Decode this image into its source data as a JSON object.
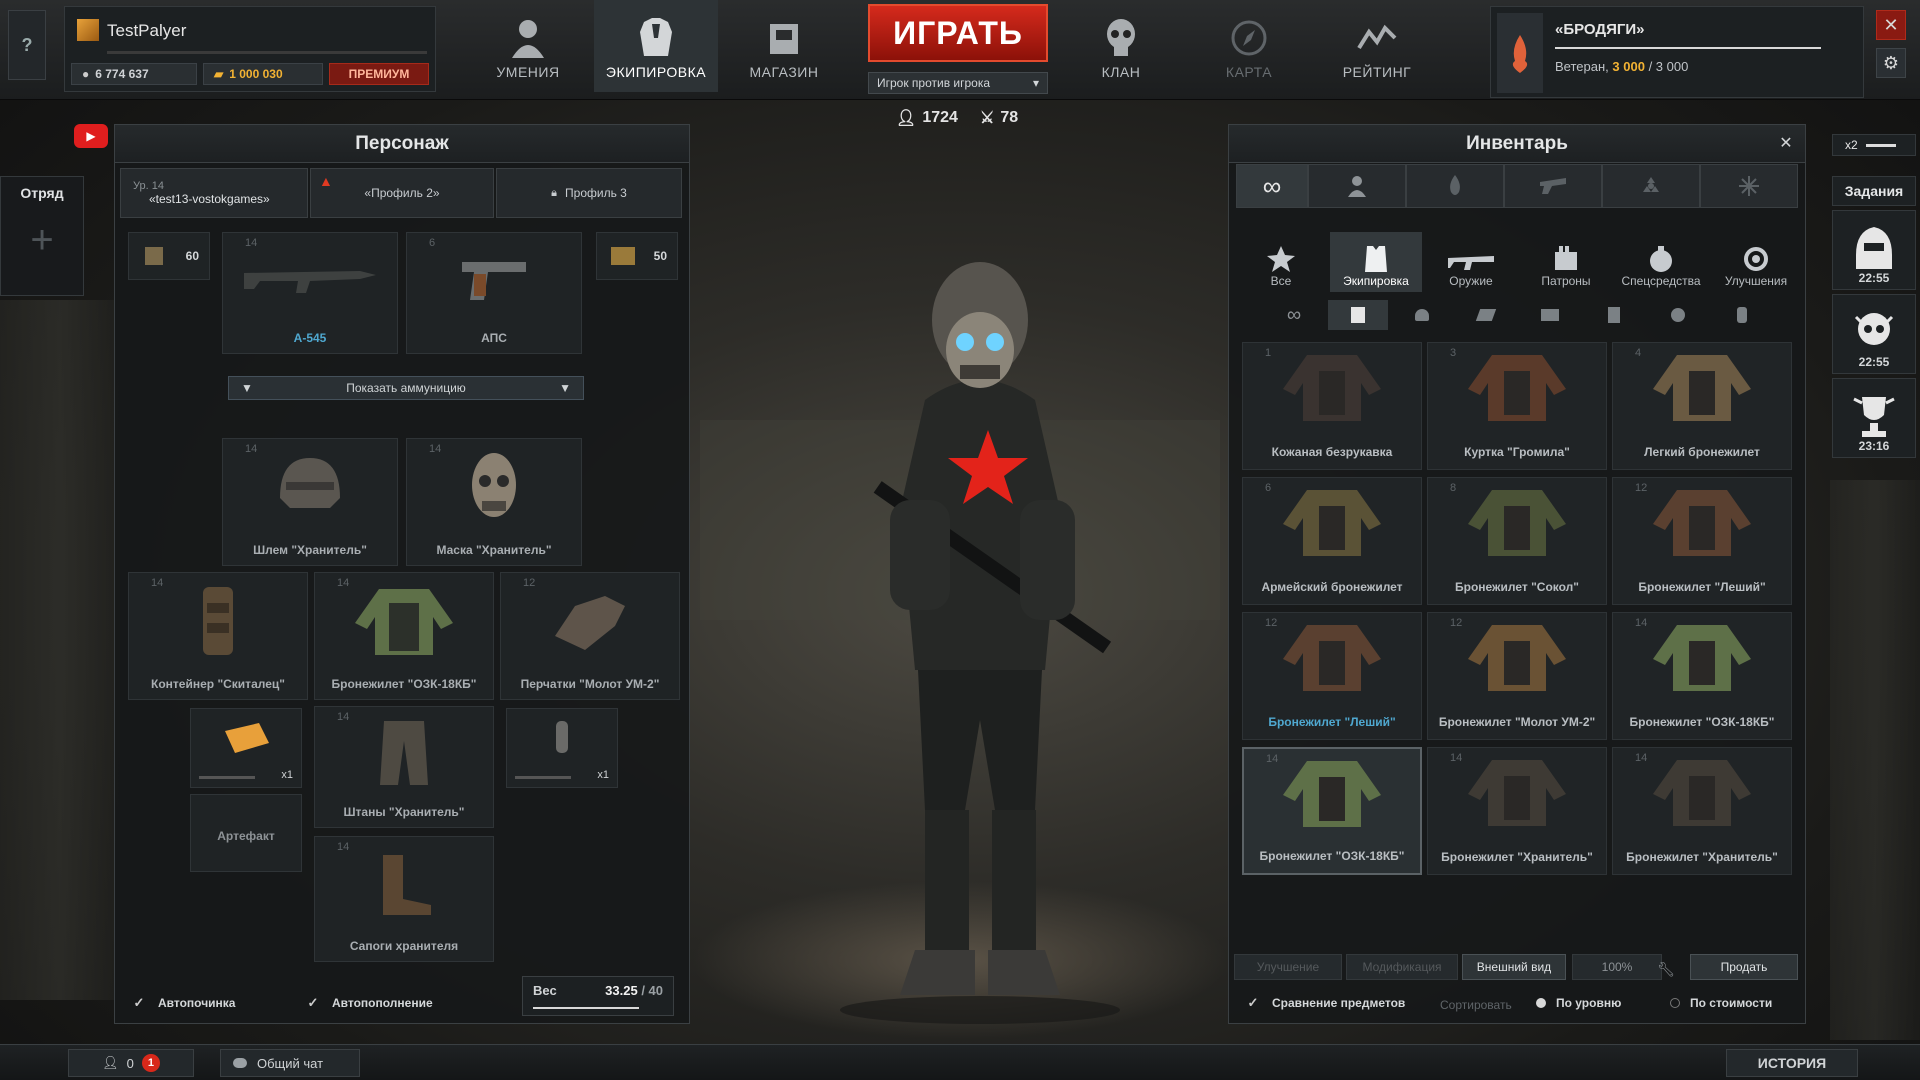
{
  "player": {
    "name": "TestPalyer",
    "silver": "6 774 637",
    "gold": "1 000 030",
    "premium_label": "ПРЕМИУМ"
  },
  "nav": [
    {
      "label": "УМЕНИЯ",
      "icon": "person-icon"
    },
    {
      "label": "ЭКИПИРОВКА",
      "icon": "armor-icon"
    },
    {
      "label": "МАГАЗИН",
      "icon": "shop-icon"
    },
    {
      "label": "КЛАН",
      "icon": "skull-icon"
    },
    {
      "label": "КАРТА",
      "icon": "map-compass-icon"
    },
    {
      "label": "РЕЙТИНГ",
      "icon": "rating-icon"
    }
  ],
  "play": {
    "label": "ИГРАТЬ",
    "mode": "Игрок против игрока"
  },
  "online": {
    "players": "1724",
    "battles": "78"
  },
  "clan": {
    "name": "«БРОДЯГИ»",
    "rank": "Ветеран,",
    "points": "3 000",
    "points_max": "/ 3 000"
  },
  "squad": {
    "label": "Отряд"
  },
  "character": {
    "title": "Персонаж",
    "profiles": [
      {
        "level": "Ур. 14",
        "name": "«test13-vostokgames»"
      },
      {
        "name": "«Профиль 2»"
      },
      {
        "name": "Профиль 3"
      }
    ],
    "ammo_left": "60",
    "ammo_right": "50",
    "weapons": [
      {
        "level": "14",
        "name": "А-545"
      },
      {
        "level": "6",
        "name": "АПС"
      }
    ],
    "show_ammo": "Показать аммуницию",
    "gear": [
      {
        "level": "14",
        "name": "Шлем \"Хранитель\""
      },
      {
        "level": "14",
        "name": "Маска \"Хранитель\""
      },
      {
        "level": "14",
        "name": "Контейнер \"Скиталец\""
      },
      {
        "level": "14",
        "name": "Бронежилет \"ОЗК-18КБ\""
      },
      {
        "level": "12",
        "name": "Перчатки \"Молот УМ-2\""
      },
      {
        "level": "14",
        "name": "Штаны \"Хранитель\""
      },
      {
        "level": "14",
        "name": "Сапоги хранителя"
      }
    ],
    "artifact_count": "x1",
    "consumable_count": "x1",
    "artifact_label": "Артефакт",
    "auto_repair": "Автопочинка",
    "auto_refill": "Автопополнение",
    "weight_label": "Вес",
    "weight_value": "33.25",
    "weight_max": "/ 40"
  },
  "inventory": {
    "title": "Инвентарь",
    "categories": [
      "Все",
      "Экипировка",
      "Оружие",
      "Патроны",
      "Спецсредства",
      "Улучшения"
    ],
    "items": [
      {
        "level": "1",
        "name": "Кожаная безрукавка"
      },
      {
        "level": "3",
        "name": "Куртка \"Громила\""
      },
      {
        "level": "4",
        "name": "Легкий бронежилет"
      },
      {
        "level": "6",
        "name": "Армейский бронежилет"
      },
      {
        "level": "8",
        "name": "Бронежилет \"Сокол\""
      },
      {
        "level": "12",
        "name": "Бронежилет \"Леший\""
      },
      {
        "level": "12",
        "name": "Бронежилет \"Леший\""
      },
      {
        "level": "12",
        "name": "Бронежилет \"Молот УМ-2\""
      },
      {
        "level": "14",
        "name": "Бронежилет \"ОЗК-18КБ\""
      },
      {
        "level": "14",
        "name": "Бронежилет \"ОЗК-18КБ\""
      },
      {
        "level": "14",
        "name": "Бронежилет \"Хранитель\""
      },
      {
        "level": "14",
        "name": "Бронежилет \"Хранитель\""
      }
    ],
    "buttons": {
      "upgrade": "Улучшение",
      "modify": "Модификация",
      "appearance": "Внешний вид",
      "percent": "100%",
      "sell": "Продать"
    },
    "compare": "Сравнение предметов",
    "sort_label": "Сортировать",
    "sort_level": "По уровню",
    "sort_cost": "По стоимости"
  },
  "quests": {
    "title": "Задания",
    "multiplier": "x2",
    "timers": [
      "22:55",
      "22:55",
      "23:16"
    ]
  },
  "bottom": {
    "friends": "0",
    "notifications": "1",
    "chat": "Общий чат",
    "history": "ИСТОРИЯ"
  },
  "colors": {
    "accent_red": "#d52a1c",
    "gold": "#f2b233",
    "premium": "#7a1a12"
  }
}
